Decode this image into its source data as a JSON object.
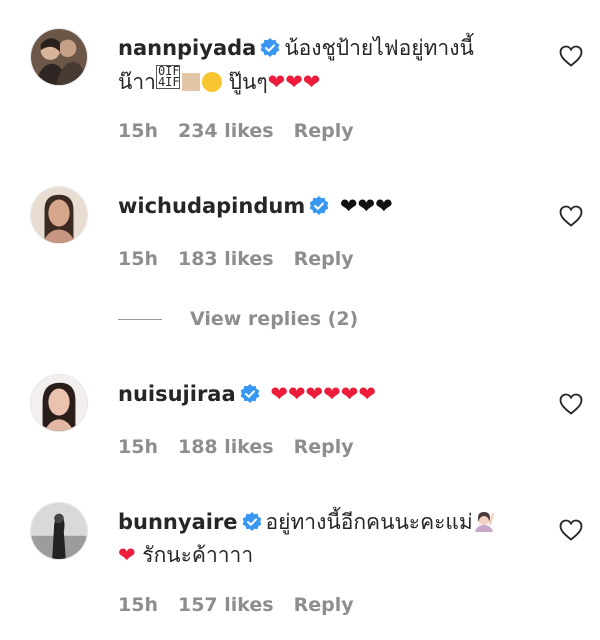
{
  "comments": [
    {
      "username": "nannpiyada",
      "verified": true,
      "text_line1": "น้องชูป้ายไฟอยู่ทางนี้",
      "text_line2_prefix": "น๊าา",
      "emoji_box_text": "0IF\n4IF",
      "text_line2_suffix": "ปู๊นๆ",
      "hearts": "❤❤❤",
      "time": "15h",
      "likes": "234 likes",
      "reply": "Reply"
    },
    {
      "username": "wichudapindum",
      "verified": true,
      "hearts": "❤❤❤",
      "time": "15h",
      "likes": "183 likes",
      "reply": "Reply"
    },
    {
      "username": "nuisujiraa",
      "verified": true,
      "hearts": "❤❤❤❤❤❤",
      "time": "15h",
      "likes": "188 likes",
      "reply": "Reply"
    },
    {
      "username": "bunnyaire",
      "verified": true,
      "text_line1": "อยู่ทางนี้อีกคนนะคะแม่",
      "heart_line2": "❤",
      "text_line2": "รักนะค้าาาา",
      "time": "15h",
      "likes": "157 likes",
      "reply": "Reply"
    }
  ],
  "view_replies": "View replies (2)",
  "icons": {
    "verified": "verified-badge-icon",
    "like": "heart-outline-icon"
  },
  "colors": {
    "verified_blue": "#3897f0",
    "heart_red": "#ed1c3a",
    "meta_gray": "#8e8e8e"
  }
}
